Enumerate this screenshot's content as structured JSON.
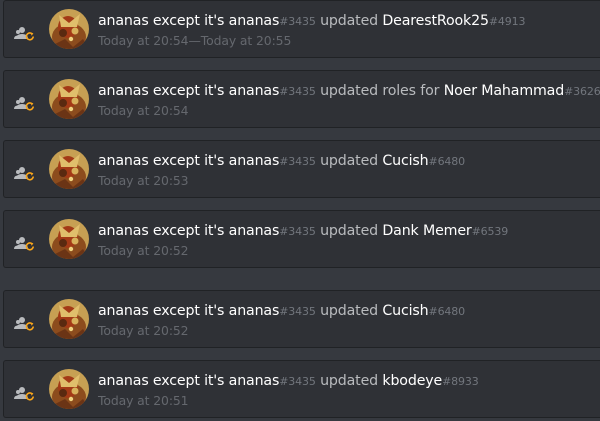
{
  "colors": {
    "background": "#36393f",
    "entry_background": "#2f3136",
    "entry_border": "#202225",
    "username": "#ffffff",
    "discriminator": "#72767d",
    "action_text": "#b9bbbe",
    "timestamp": "#65686e",
    "update_badge": "#faa61a",
    "member_icon": "#b9bbbe"
  },
  "entries": [
    {
      "actor_name": "ananas except it's ananas",
      "actor_discriminator": "#3435",
      "action": "updated",
      "target_name": "DearestRook25",
      "target_discriminator": "#4913",
      "time": "Today at 20:54—Today at 20:55",
      "action_icon": "member-update-icon"
    },
    {
      "actor_name": "ananas except it's ananas",
      "actor_discriminator": "#3435",
      "action": "updated roles for",
      "target_name": "Noer Mahammad",
      "target_discriminator": "#3626",
      "time": "Today at 20:54",
      "action_icon": "member-update-icon"
    },
    {
      "actor_name": "ananas except it's ananas",
      "actor_discriminator": "#3435",
      "action": "updated",
      "target_name": "Cucish",
      "target_discriminator": "#6480",
      "time": "Today at 20:53",
      "action_icon": "member-update-icon"
    },
    {
      "actor_name": "ananas except it's ananas",
      "actor_discriminator": "#3435",
      "action": "updated",
      "target_name": "Dank Memer",
      "target_discriminator": "#6539",
      "time": "Today at 20:52",
      "action_icon": "member-update-icon"
    },
    {
      "actor_name": "ananas except it's ananas",
      "actor_discriminator": "#3435",
      "action": "updated",
      "target_name": "Cucish",
      "target_discriminator": "#6480",
      "time": "Today at 20:52",
      "action_icon": "member-update-icon"
    },
    {
      "actor_name": "ananas except it's ananas",
      "actor_discriminator": "#3435",
      "action": "updated",
      "target_name": "kbodeye",
      "target_discriminator": "#8933",
      "time": "Today at 20:51",
      "action_icon": "member-update-icon"
    }
  ]
}
